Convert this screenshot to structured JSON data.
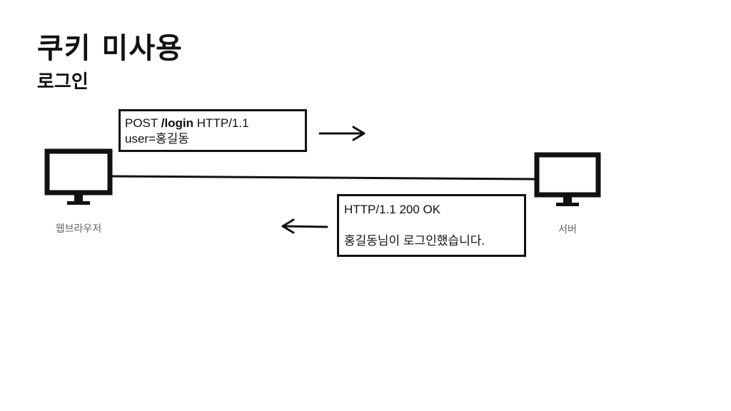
{
  "slide": {
    "title": "쿠키 미사용",
    "subtitle": "로그인"
  },
  "nodes": {
    "browser": {
      "label": "웹브라우저",
      "icon": "monitor-icon"
    },
    "server": {
      "label": "서버",
      "icon": "monitor-icon"
    }
  },
  "request": {
    "method": "POST",
    "path": "/login",
    "version": "HTTP/1.1",
    "body": "user=홍길동"
  },
  "response": {
    "status_line": "HTTP/1.1 200 OK",
    "body": "홍길동님이 로그인했습니다."
  },
  "colors": {
    "stroke": "#111111",
    "label": "#666666",
    "background": "#ffffff"
  }
}
